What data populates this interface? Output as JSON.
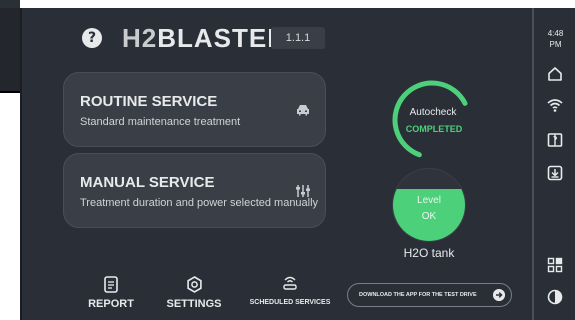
{
  "header": {
    "brand_prefix": "H2",
    "brand_suffix": "BLASTER",
    "version": "1.1.1",
    "help_glyph": "?"
  },
  "services": [
    {
      "title": "ROUTINE SERVICE",
      "subtitle": "Standard maintenance treatment",
      "icon": "car-icon"
    },
    {
      "title": "MANUAL SERVICE",
      "subtitle": "Treatment duration and power selected manually",
      "icon": "sliders-icon"
    }
  ],
  "autocheck": {
    "title": "Autocheck",
    "status": "COMPLETED",
    "progress_fraction": 0.62,
    "color": "#4cd07a"
  },
  "level": {
    "label": "Level",
    "value": "OK",
    "fill_fraction": 0.72,
    "tank_label": "H2O tank",
    "color": "#4cd07a"
  },
  "bottom_nav": {
    "report": "REPORT",
    "settings": "SETTINGS",
    "scheduled": "SCHEDULED SERVICES"
  },
  "download": {
    "label": "DOWNLOAD THE APP FOR THE TEST DRIVE"
  },
  "status_bar": {
    "time_line1": "4:48",
    "time_line2": "PM",
    "icons": [
      "home-icon",
      "wifi-icon",
      "manual-icon",
      "download-icon",
      "apps-icon",
      "theme-icon"
    ]
  },
  "colors": {
    "background": "#2a2f37",
    "card": "#3a3f47",
    "accent": "#4cd07a",
    "text": "#e8e9eb"
  }
}
